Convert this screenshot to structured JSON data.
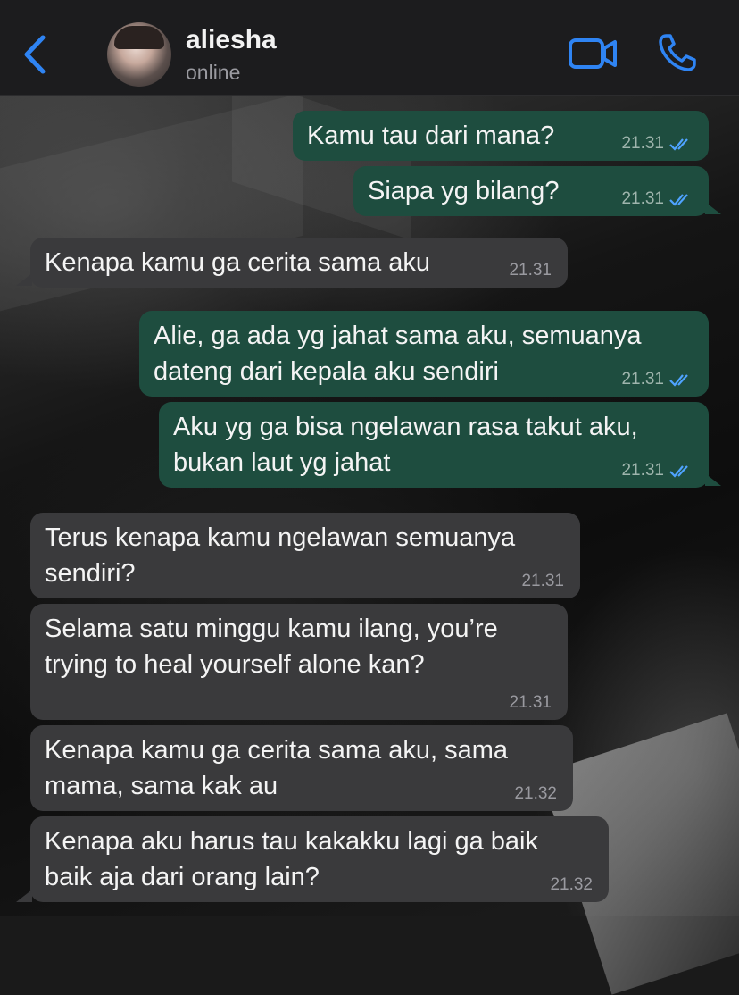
{
  "header": {
    "contact_name": "aliesha",
    "contact_status": "online",
    "icons": [
      "back-chevron-icon",
      "avatar",
      "video-call-icon",
      "voice-call-icon"
    ],
    "accent_color": "#2f84f3"
  },
  "messages": [
    {
      "direction": "out",
      "text": "Kamu tau dari mana?",
      "time": "21.31",
      "read": true
    },
    {
      "direction": "out",
      "text": "Siapa yg bilang?",
      "time": "21.31",
      "read": true
    },
    {
      "direction": "in",
      "text": "Kenapa kamu ga cerita sama aku",
      "time": "21.31"
    },
    {
      "direction": "out",
      "text": "Alie, ga ada yg jahat sama aku, semuanya\ndateng dari kepala aku sendiri",
      "time": "21.31",
      "read": true
    },
    {
      "direction": "out",
      "text": "Aku yg ga bisa ngelawan rasa takut aku,\nbukan laut yg jahat",
      "time": "21.31",
      "read": true
    },
    {
      "direction": "in",
      "text": "Terus kenapa kamu ngelawan semuanya\nsendiri?",
      "time": "21.31"
    },
    {
      "direction": "in",
      "text": "Selama satu minggu kamu ilang, you’re\ntrying to heal yourself alone kan?",
      "time": "21.31"
    },
    {
      "direction": "in",
      "text": "Kenapa kamu ga cerita sama aku, sama\nmama, sama kak au",
      "time": "21.32"
    },
    {
      "direction": "in",
      "text": "Kenapa aku harus tau kakakku lagi ga baik\nbaik aja dari orang lain?",
      "time": "21.32"
    }
  ],
  "colors": {
    "outgoing_bubble": "#1e4d3f",
    "incoming_bubble": "#3a3a3c",
    "read_tick": "#4fa3ff"
  }
}
